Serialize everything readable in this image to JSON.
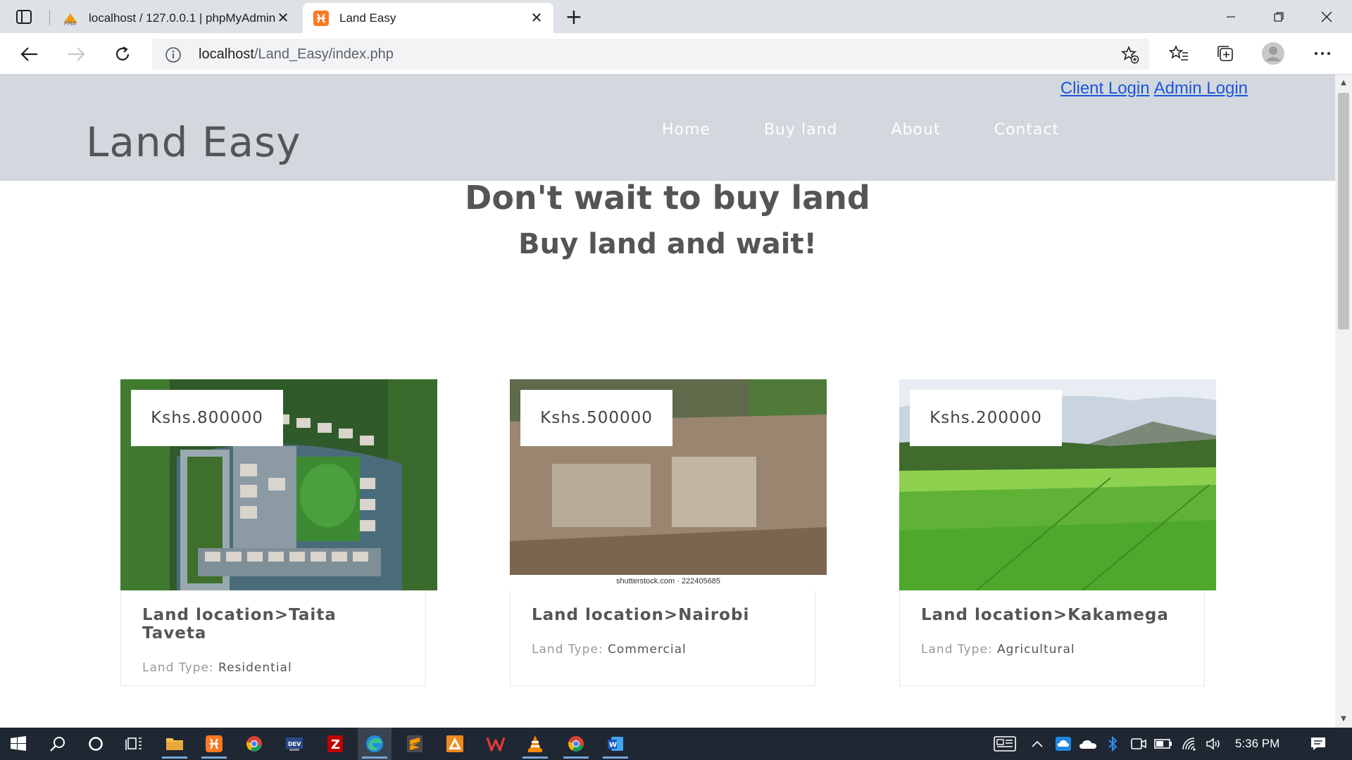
{
  "browser": {
    "tabs": [
      {
        "title": "localhost / 127.0.0.1 | phpMyAdmin",
        "favicon": "phpmyadmin-icon",
        "active": false
      },
      {
        "title": "Land Easy",
        "favicon": "xampp-icon",
        "active": true
      }
    ],
    "url_host": "localhost",
    "url_path": "/Land_Easy/index.php"
  },
  "site": {
    "header": {
      "login_links": [
        "Client Login",
        "Admin Login"
      ],
      "brand": "Land Easy",
      "nav": [
        "Home",
        "Buy land",
        "About",
        "Contact"
      ]
    },
    "hero": {
      "title": "Don't wait to buy land",
      "subtitle": "Buy land and wait!"
    },
    "listings": [
      {
        "price": "Kshs.800000",
        "location": "Land location>Taita Taveta",
        "type_label": "Land Type:",
        "type": "Residential",
        "image": "aerial-residential-estate"
      },
      {
        "price": "Kshs.500000",
        "location": "Land location>Nairobi",
        "type_label": "Land Type:",
        "type": "Commercial",
        "image": "construction-site-aerial",
        "watermark": "shutterstock.com · 222405685"
      },
      {
        "price": "Kshs.200000",
        "location": "Land location>Kakamega",
        "type_label": "Land Type:",
        "type": "Agricultural",
        "image": "green-farm-fields"
      }
    ]
  },
  "taskbar": {
    "apps": [
      "start-icon",
      "search-icon",
      "cortana-icon",
      "task-view-icon",
      "file-explorer-icon",
      "xampp-icon",
      "chrome-icon",
      "dev-cpp-icon",
      "filezilla-icon",
      "edge-icon",
      "sublime-icon",
      "app-icon",
      "wps-icon",
      "vlc-icon",
      "chrome-icon",
      "word-icon"
    ],
    "time": "5:36 PM"
  },
  "colors": {
    "header_bg": "#d3d7de",
    "link": "#1a56db",
    "taskbar_bg": "#1f2733"
  }
}
